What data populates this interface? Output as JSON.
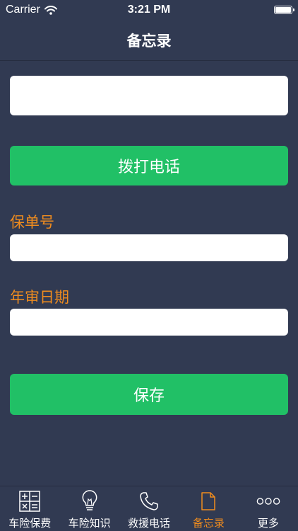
{
  "status_bar": {
    "carrier": "Carrier",
    "time": "3:21 PM",
    "icons": [
      "wifi-icon",
      "battery-icon"
    ]
  },
  "nav": {
    "title": "备忘录"
  },
  "form": {
    "phone_input_value": "",
    "call_button_label": "拨打电话",
    "policy_label": "保单号",
    "policy_input_value": "",
    "inspection_label": "年审日期",
    "inspection_input_value": "",
    "save_button_label": "保存"
  },
  "tabs": [
    {
      "label": "车险保费",
      "icon": "calculator-icon",
      "active": false
    },
    {
      "label": "车险知识",
      "icon": "lightbulb-icon",
      "active": false
    },
    {
      "label": "救援电话",
      "icon": "phone-icon",
      "active": false
    },
    {
      "label": "备忘录",
      "icon": "document-icon",
      "active": true
    },
    {
      "label": "更多",
      "icon": "more-icon",
      "active": false
    }
  ],
  "colors": {
    "background": "#313a52",
    "button_green": "#21c066",
    "accent_orange": "#f08c1e",
    "text_white": "#ffffff"
  }
}
